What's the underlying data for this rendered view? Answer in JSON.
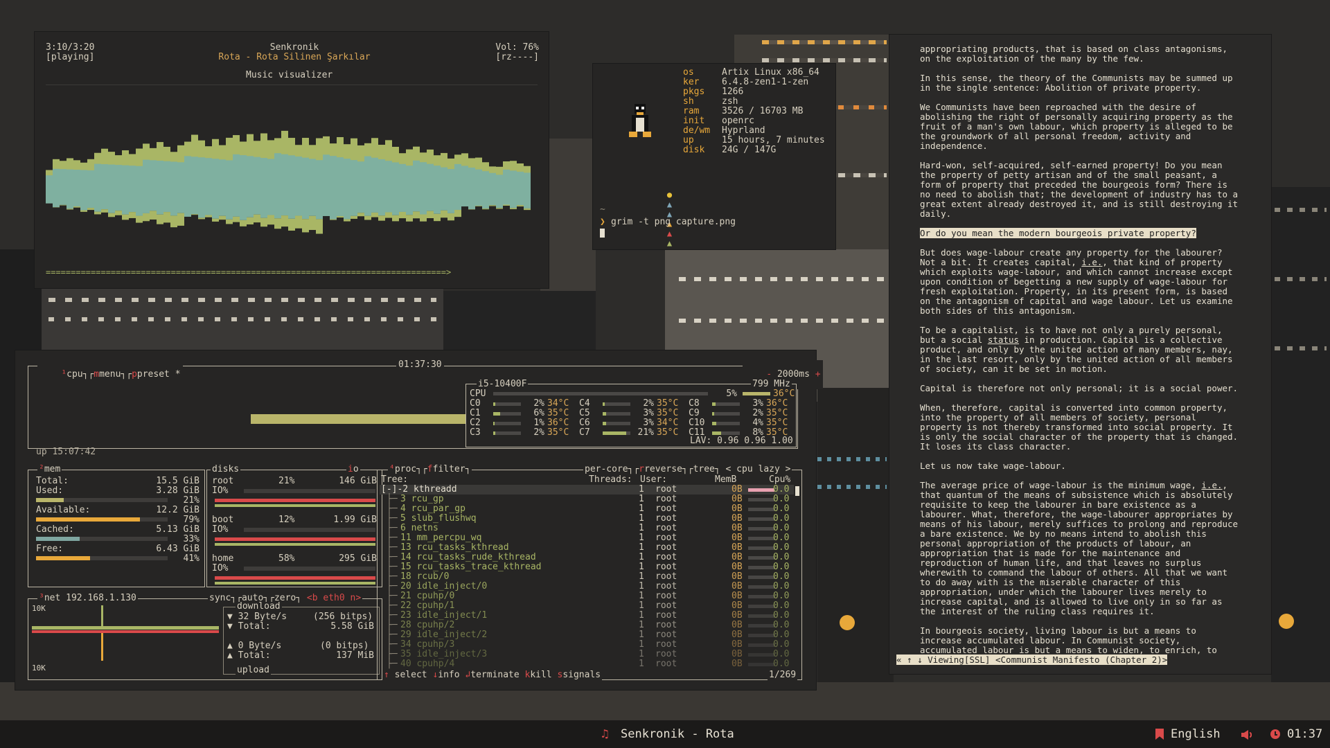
{
  "music": {
    "time": "3:10/3:20",
    "state": "[playing]",
    "title": "Senkronik",
    "song": "Rota - Rota Silinen Şarkılar",
    "vol": "Vol: 76%",
    "flags": "[rz----]",
    "heading": "Music visualizer",
    "progress": "================================================================================>"
  },
  "fetch": {
    "rows": [
      {
        "k": "os",
        "v": "Artix Linux x86_64"
      },
      {
        "k": "ker",
        "v": "6.4.8-zen1-1-zen"
      },
      {
        "k": "pkgs",
        "v": "1266"
      },
      {
        "k": "sh",
        "v": "zsh"
      },
      {
        "k": "ram",
        "v": "3526 / 16703 MB"
      },
      {
        "k": "init",
        "v": "openrc"
      },
      {
        "k": "de/wm",
        "v": "Hyprland"
      },
      {
        "k": "up",
        "v": "15 hours, 7 minutes"
      },
      {
        "k": "disk",
        "v": "24G / 147G"
      }
    ],
    "tilde": "~",
    "prompt": "❯",
    "command": "grim -t png capture.png"
  },
  "btop": {
    "cpu_tab": "cpu",
    "menu_tab": "menu",
    "preset_tab": "preset *",
    "clock": "01:37:30",
    "interval": "2000ms",
    "uptime": "up 15:07:42",
    "cpu_model": "i5-10400F",
    "cpu_freq": "799 MHz",
    "cpu_total_label": "CPU",
    "cpu_total_pct": "5%",
    "cpu_total_temp": "36°C",
    "cores": [
      {
        "n": "C0",
        "p": "2%",
        "t": "34°C"
      },
      {
        "n": "C1",
        "p": "6%",
        "t": "35°C"
      },
      {
        "n": "C2",
        "p": "1%",
        "t": "36°C"
      },
      {
        "n": "C3",
        "p": "2%",
        "t": "35°C"
      },
      {
        "n": "C4",
        "p": "2%",
        "t": "35°C"
      },
      {
        "n": "C5",
        "p": "3%",
        "t": "35°C"
      },
      {
        "n": "C6",
        "p": "3%",
        "t": "34°C"
      },
      {
        "n": "C7",
        "p": "21%",
        "t": "35°C"
      },
      {
        "n": "C8",
        "p": "3%",
        "t": "36°C"
      },
      {
        "n": "C9",
        "p": "2%",
        "t": "35°C"
      },
      {
        "n": "C10",
        "p": "4%",
        "t": "35°C"
      },
      {
        "n": "C11",
        "p": "8%",
        "t": "35°C"
      }
    ],
    "lav": "LAV: 0.96 0.96 1.00",
    "mem": {
      "title": "mem",
      "total_l": "Total:",
      "total_v": "15.5 GiB",
      "used_l": "Used:",
      "used_v": "3.28 GiB",
      "used_p": "21%",
      "avail_l": "Available:",
      "avail_v": "12.2 GiB",
      "avail_p": "79%",
      "cached_l": "Cached:",
      "cached_v": "5.13 GiB",
      "cached_p": "33%",
      "free_l": "Free:",
      "free_v": "6.43 GiB",
      "free_p": "41%"
    },
    "disks": {
      "title": "disks",
      "io": "io",
      "items": [
        {
          "name": "root",
          "pct": "21%",
          "size": "146 GiB",
          "io": "IO%"
        },
        {
          "name": "boot",
          "pct": "12%",
          "size": "1.99 GiB",
          "io": "IO%"
        },
        {
          "name": "home",
          "pct": "58%",
          "size": "295 GiB",
          "io": "IO%"
        }
      ]
    },
    "net": {
      "title": "net",
      "ip": "192.168.1.130",
      "sync": "sync",
      "auto": "auto",
      "zero": "zero",
      "iface": "<b eth0 n>",
      "scale_top": "10K",
      "scale_bottom": "10K",
      "download": "download",
      "down_rate": "▼ 32 Byte/s",
      "down_bits": "(256 bitps)",
      "down_total_l": "▼ Total:",
      "down_total": "5.58 GiB",
      "up_rate": "▲ 0 Byte/s",
      "up_bits": "(0 bitps)",
      "up_total_l": "▲ Total:",
      "up_total": "137 MiB",
      "upload": "upload"
    },
    "proc": {
      "title": "proc",
      "filter": "filter",
      "per_core": "per-core",
      "reverse": "reverse",
      "tree": "tree",
      "sort": "< cpu lazy >",
      "col_tree": "Tree:",
      "col_threads": "Threads:",
      "col_user": "User:",
      "col_mem": "MemB",
      "col_cpu": "Cpu%",
      "rows": [
        {
          "name": "[-]-2 kthreadd",
          "th": "1",
          "user": "root",
          "mem": "0B",
          "cpu": "0.0"
        },
        {
          "name": "3 rcu_gp",
          "th": "1",
          "user": "root",
          "mem": "0B",
          "cpu": "0.0"
        },
        {
          "name": "4 rcu_par_gp",
          "th": "1",
          "user": "root",
          "mem": "0B",
          "cpu": "0.0"
        },
        {
          "name": "5 slub_flushwq",
          "th": "1",
          "user": "root",
          "mem": "0B",
          "cpu": "0.0"
        },
        {
          "name": "6 netns",
          "th": "1",
          "user": "root",
          "mem": "0B",
          "cpu": "0.0"
        },
        {
          "name": "11 mm_percpu_wq",
          "th": "1",
          "user": "root",
          "mem": "0B",
          "cpu": "0.0"
        },
        {
          "name": "13 rcu_tasks_kthread",
          "th": "1",
          "user": "root",
          "mem": "0B",
          "cpu": "0.0"
        },
        {
          "name": "14 rcu_tasks_rude_kthread",
          "th": "1",
          "user": "root",
          "mem": "0B",
          "cpu": "0.0"
        },
        {
          "name": "15 rcu_tasks_trace_kthread",
          "th": "1",
          "user": "root",
          "mem": "0B",
          "cpu": "0.0"
        },
        {
          "name": "18 rcub/0",
          "th": "1",
          "user": "root",
          "mem": "0B",
          "cpu": "0.0"
        },
        {
          "name": "20 idle_inject/0",
          "th": "1",
          "user": "root",
          "mem": "0B",
          "cpu": "0.0"
        },
        {
          "name": "21 cpuhp/0",
          "th": "1",
          "user": "root",
          "mem": "0B",
          "cpu": "0.0"
        },
        {
          "name": "22 cpuhp/1",
          "th": "1",
          "user": "root",
          "mem": "0B",
          "cpu": "0.0"
        },
        {
          "name": "23 idle_inject/1",
          "th": "1",
          "user": "root",
          "mem": "0B",
          "cpu": "0.0"
        },
        {
          "name": "28 cpuhp/2",
          "th": "1",
          "user": "root",
          "mem": "0B",
          "cpu": "0.0"
        },
        {
          "name": "29 idle_inject/2",
          "th": "1",
          "user": "root",
          "mem": "0B",
          "cpu": "0.0"
        },
        {
          "name": "34 cpuhp/3",
          "th": "1",
          "user": "root",
          "mem": "0B",
          "cpu": "0.0"
        },
        {
          "name": "35 idle_inject/3",
          "th": "1",
          "user": "root",
          "mem": "0B",
          "cpu": "0.0"
        },
        {
          "name": "40 cpuhp/4",
          "th": "1",
          "user": "root",
          "mem": "0B",
          "cpu": "0.0"
        }
      ],
      "select": "select",
      "info": "info",
      "terminate": "terminate",
      "kill": "kill",
      "signals": "signals",
      "count": "1/269"
    }
  },
  "reader": {
    "p1": "appropriating products, that is based on class antagonisms,\non the exploitation of the many by the few.",
    "p2": "In this sense, the theory of the Communists may be summed up\nin the single sentence: Abolition of private property.",
    "p3": "We Communists have been reproached with the desire of\nabolishing the right of personally acquiring property as the\nfruit of a man's own labour, which property is alleged to be\nthe groundwork of all personal freedom, activity and\nindependence.",
    "p4": "Hard-won, self-acquired, self-earned property! Do you mean\nthe property of petty artisan and of the small peasant, a\nform of property that preceded the bourgeois form? There is\nno need to abolish that; the development of industry has to a\ngreat extent already destroyed it, and is still destroying it\ndaily.",
    "p5": "Or do you mean the modern bourgeois private property?",
    "p6a": "But does wage-labour create any property for the labourer?\nNot a bit. It creates capital, ",
    "p6u": "i.e.",
    "p6b": ", that kind of property\nwhich exploits wage-labour, and which cannot increase except\nupon condition of begetting a new supply of wage-labour for\nfresh exploitation. Property, in its present form, is based\non the antagonism of capital and wage labour. Let us examine\nboth sides of this antagonism.",
    "p7a": "To be a capitalist, is to have not only a purely personal,\nbut a social ",
    "p7u": "status",
    "p7b": " in production. Capital is a collective\nproduct, and only by the united action of many members, nay,\nin the last resort, only by the united action of all members\nof society, can it be set in motion.",
    "p8": "Capital is therefore not only personal; it is a social power.",
    "p9": "When, therefore, capital is converted into common property,\ninto the property of all members of society, personal\nproperty is not thereby transformed into social property. It\nis only the social character of the property that is changed.\nIt loses its class character.",
    "p10": "Let us now take wage-labour.",
    "p11a": "The average price of wage-labour is the minimum wage, ",
    "p11u": "i.e.",
    "p11b": ",\nthat quantum of the means of subsistence which is absolutely\nrequisite to keep the labourer in bare existence as a\nlabourer. What, therefore, the wage-labourer appropriates by\nmeans of his labour, merely suffices to prolong and reproduce\na bare existence. We by no means intend to abolish this\npersonal appropriation of the products of labour, an\nappropriation that is made for the maintenance and\nreproduction of human life, and that leaves no surplus\nwherewith to command the labour of others. All that we want\nto do away with is the miserable character of this\nappropriation, under which the labourer lives merely to\nincrease capital, and is allowed to live only in so far as\nthe interest of the ruling class requires it.",
    "p12": "In bourgeois society, living labour is but a means to\nincrease accumulated labour. In Communist society,\naccumulated labour is but a means to widen, to enrich, to",
    "status": "« ↑ ↓ Viewing[SSL] <Communist Manifesto (Chapter 2)>"
  },
  "statusbar": {
    "music_icon": "♫",
    "now_playing": "Senkronik - Rota",
    "lang": "English",
    "clock": "01:37"
  }
}
